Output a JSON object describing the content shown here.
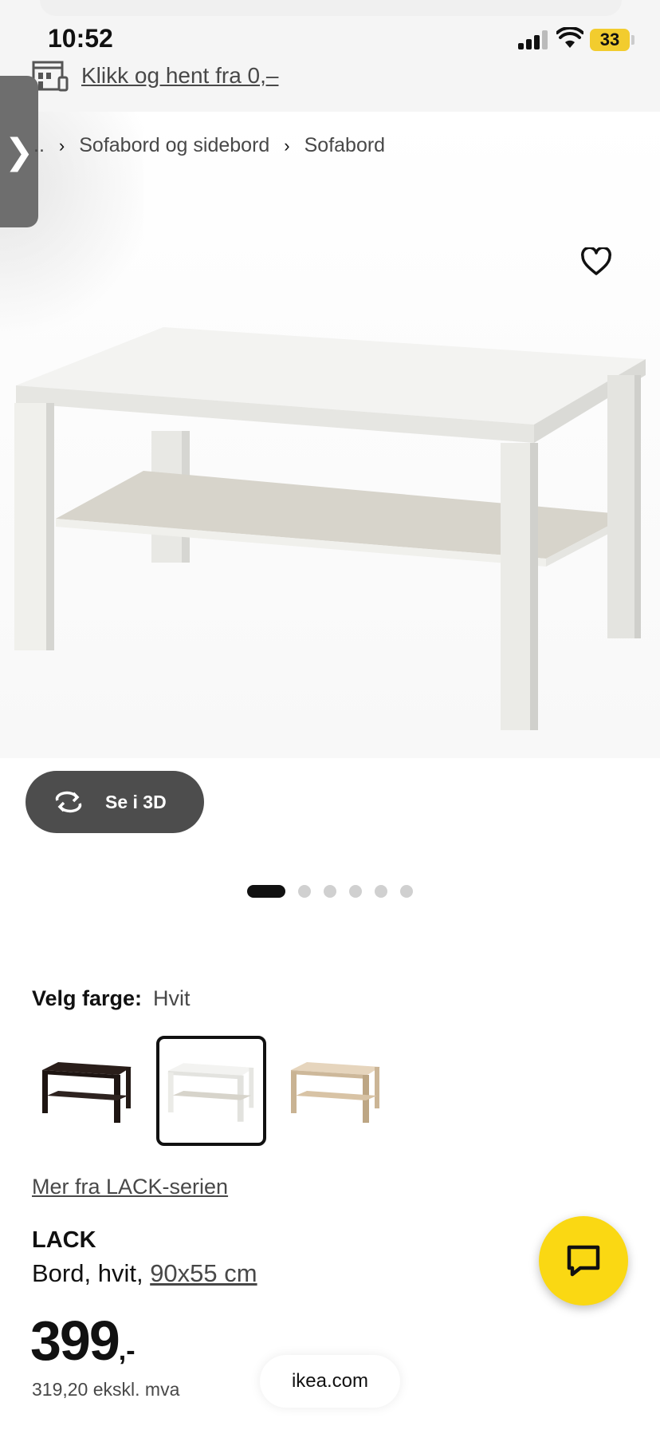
{
  "status_bar": {
    "time": "10:52",
    "battery": "33",
    "icons": [
      "cellular-signal-icon",
      "wifi-icon",
      "battery-icon"
    ]
  },
  "header": {
    "click_collect_label": "Klikk og hent fra 0,–",
    "store_icon": "store-icon",
    "side_tab_glyph": "❯"
  },
  "breadcrumb": {
    "items": [
      "..",
      "Sofabord og sidebord",
      "Sofabord"
    ]
  },
  "gallery": {
    "favorite_icon": "heart-icon",
    "view_3d_label": "Se i 3D",
    "dots_count": 6,
    "active_dot": 0
  },
  "color_select": {
    "label": "Velg farge:",
    "value": "Hvit",
    "options": [
      {
        "name": "black-brown",
        "color": "#2a1e1a"
      },
      {
        "name": "white",
        "color": "#f2f2ee",
        "selected": true
      },
      {
        "name": "white-stained-oak",
        "color": "#d8c3a5"
      }
    ]
  },
  "product": {
    "series_link": "Mer fra LACK-serien",
    "name": "LACK",
    "description_prefix": "Bord, hvit, ",
    "size_link": "90x55 cm",
    "price": "399",
    "price_suffix": ",-",
    "price_ex_vat": "319,20 ekskl. mva"
  },
  "chat": {
    "icon": "chat-bubble-icon",
    "color": "#fad813"
  },
  "browser": {
    "url": "ikea.com"
  }
}
